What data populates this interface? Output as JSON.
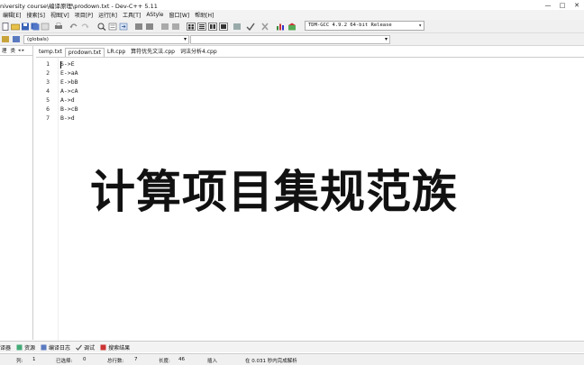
{
  "window": {
    "title": "niversity course\\编译原理\\prodown.txt - Dev-C++ 5.11",
    "controls": [
      "—",
      "□",
      "✕"
    ]
  },
  "menu": [
    "编辑[E]",
    "搜索[S]",
    "视图[V]",
    "项目[P]",
    "运行[R]",
    "工具[T]",
    "AStyle",
    "窗口[W]",
    "帮助[H]"
  ],
  "toolbar": {
    "compiler": "TDM-GCC 4.9.2 64-bit Release"
  },
  "scope": {
    "value": "(globals)"
  },
  "left_panel": {
    "tabs": [
      "理",
      "类"
    ]
  },
  "file_tabs": [
    "temp.txt",
    "prodown.txt",
    "LR.cpp",
    "算符优先文法.cpp",
    "词法分析4.cpp"
  ],
  "editor": {
    "lines": [
      {
        "num": "1",
        "text": "S->E"
      },
      {
        "num": "2",
        "text": "E->aA"
      },
      {
        "num": "3",
        "text": "E->bB"
      },
      {
        "num": "4",
        "text": "A->cA"
      },
      {
        "num": "5",
        "text": "A->d"
      },
      {
        "num": "6",
        "text": "B->cB"
      },
      {
        "num": "7",
        "text": "B->d"
      }
    ]
  },
  "overlay_text": "计算项目集规范族",
  "bottom_tabs": [
    "译器",
    "资源",
    "编译日志",
    "调试",
    "搜索结果"
  ],
  "status": {
    "row_label": "列:",
    "row_value": "1",
    "sel_label": "已选择:",
    "sel_value": "0",
    "total_label": "总行数:",
    "total_value": "7",
    "len_label": "长度:",
    "len_value": "46",
    "mode": "插入",
    "parse": "在 0.031 秒内完成解析"
  }
}
